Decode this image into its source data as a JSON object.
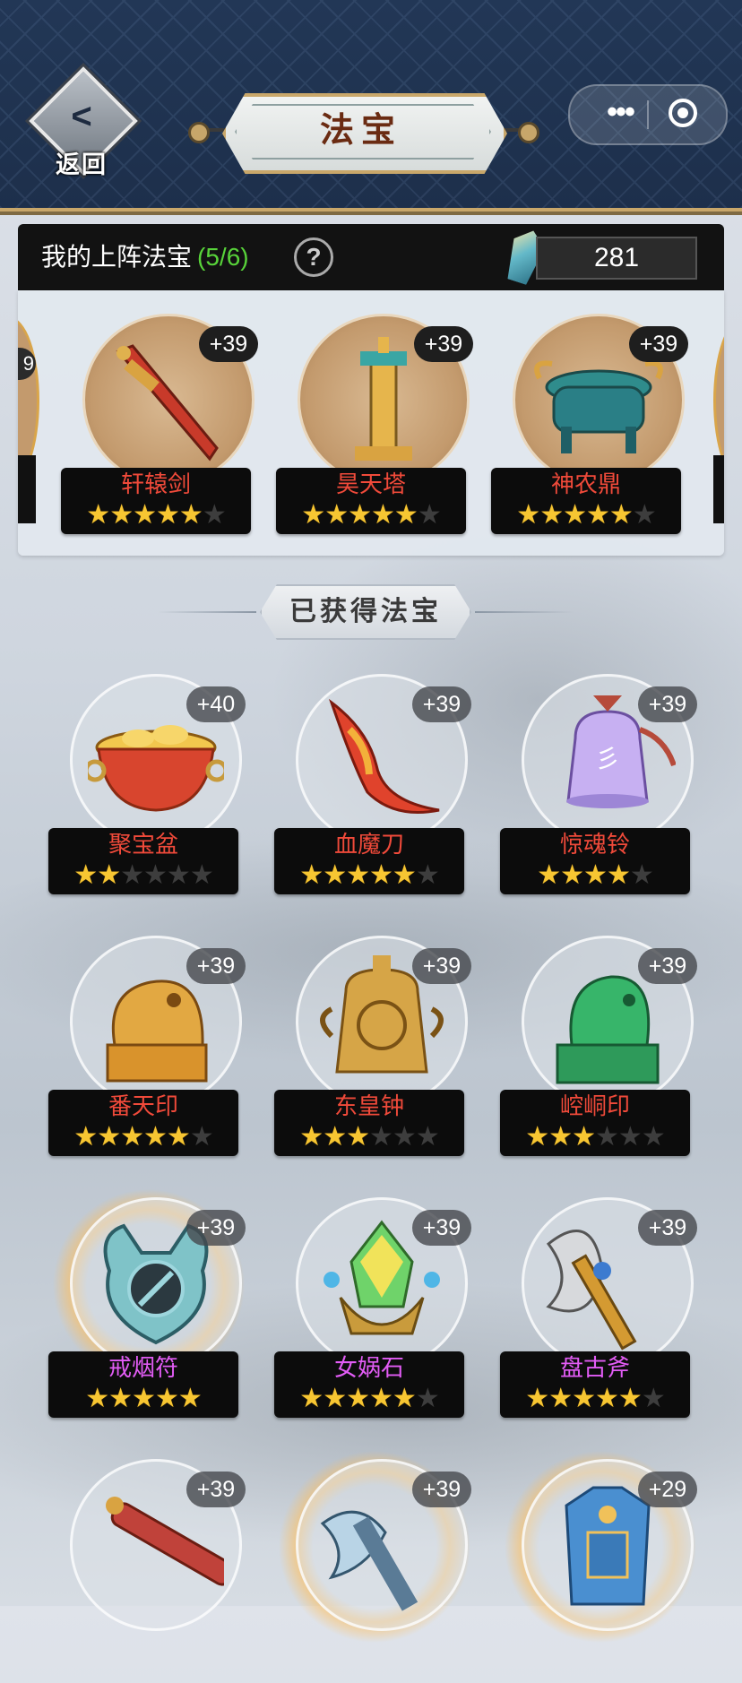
{
  "header": {
    "back_label": "返回",
    "title": "法宝",
    "menu_icon": "more-dots-icon",
    "close_icon": "target-close-icon"
  },
  "equipped": {
    "label": "我的上阵法宝",
    "count": "(5/6)",
    "help": "?",
    "currency_value": "281",
    "left_edge_badge": "9",
    "items": [
      {
        "name": "轩辕剑",
        "level": "+39",
        "stars": 5,
        "max_stars": 6,
        "icon": "xuanyuan-sword-icon"
      },
      {
        "name": "昊天塔",
        "level": "+39",
        "stars": 5,
        "max_stars": 6,
        "icon": "haotian-tower-icon"
      },
      {
        "name": "神农鼎",
        "level": "+39",
        "stars": 5,
        "max_stars": 6,
        "icon": "shennong-cauldron-icon"
      }
    ]
  },
  "owned": {
    "title": "已获得法宝",
    "items": [
      {
        "name": "聚宝盆",
        "level": "+40",
        "stars": 2,
        "max_stars": 6,
        "color": "red",
        "icon": "treasure-bowl-icon"
      },
      {
        "name": "血魔刀",
        "level": "+39",
        "stars": 5,
        "max_stars": 6,
        "color": "red",
        "icon": "blood-blade-icon"
      },
      {
        "name": "惊魂铃",
        "level": "+39",
        "stars": 4,
        "max_stars": 5,
        "color": "red",
        "icon": "soul-bell-icon"
      },
      {
        "name": "番天印",
        "level": "+39",
        "stars": 5,
        "max_stars": 6,
        "color": "red",
        "icon": "heaven-seal-icon"
      },
      {
        "name": "东皇钟",
        "level": "+39",
        "stars": 3,
        "max_stars": 6,
        "color": "red",
        "icon": "donghuang-bell-icon"
      },
      {
        "name": "崆峒印",
        "level": "+39",
        "stars": 3,
        "max_stars": 6,
        "color": "red",
        "icon": "jade-seal-icon"
      },
      {
        "name": "戒烟符",
        "level": "+39",
        "stars": 5,
        "max_stars": 5,
        "color": "purple",
        "icon": "talisman-icon",
        "glow": true
      },
      {
        "name": "女娲石",
        "level": "+39",
        "stars": 5,
        "max_stars": 6,
        "color": "purple",
        "icon": "nuwa-stone-icon"
      },
      {
        "name": "盘古斧",
        "level": "+39",
        "stars": 5,
        "max_stars": 6,
        "color": "purple",
        "icon": "pangu-axe-icon"
      },
      {
        "name": "",
        "level": "+39",
        "stars": 0,
        "max_stars": 0,
        "color": "red",
        "icon": "flute-icon"
      },
      {
        "name": "",
        "level": "+39",
        "stars": 0,
        "max_stars": 0,
        "color": "red",
        "icon": "ice-axe-icon",
        "glow": true
      },
      {
        "name": "",
        "level": "+29",
        "stars": 0,
        "max_stars": 0,
        "color": "red",
        "icon": "armor-icon",
        "glow": true
      }
    ]
  }
}
